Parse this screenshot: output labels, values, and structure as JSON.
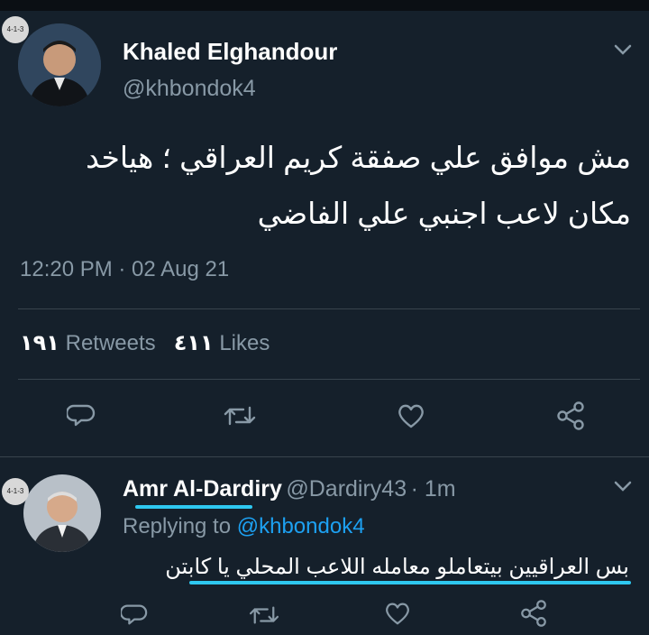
{
  "tweet": {
    "author_name": "Khaled Elghandour",
    "author_handle": "@khbondok4",
    "badge": "4-1-3",
    "line1": "مش موافق علي صفقة كريم العراقي ؛ هياخد",
    "line2": "مكان لاعب اجنبي علي الفاضي",
    "timestamp": "12:20 PM · 02 Aug 21",
    "retweets_count": "١٩١",
    "retweets_label": "Retweets",
    "likes_count": "٤١١",
    "likes_label": "Likes"
  },
  "reply": {
    "author_name": "Amr Al-Dardiry",
    "author_handle": "@Dardiry43",
    "time": "· 1m",
    "badge": "4-1-3",
    "replying_prefix": "Replying to",
    "replying_to": "@khbondok4",
    "text": "بس العراقيين بيتعاملو معامله اللاعب المحلي يا كابتن"
  },
  "icons": [
    "reply-icon",
    "retweet-icon",
    "like-icon",
    "share-icon",
    "chevron-down-icon"
  ],
  "colors": {
    "background": "#15202b",
    "muted": "#8899a6",
    "link": "#1da1f2",
    "annotation": "#2ec8f0"
  }
}
